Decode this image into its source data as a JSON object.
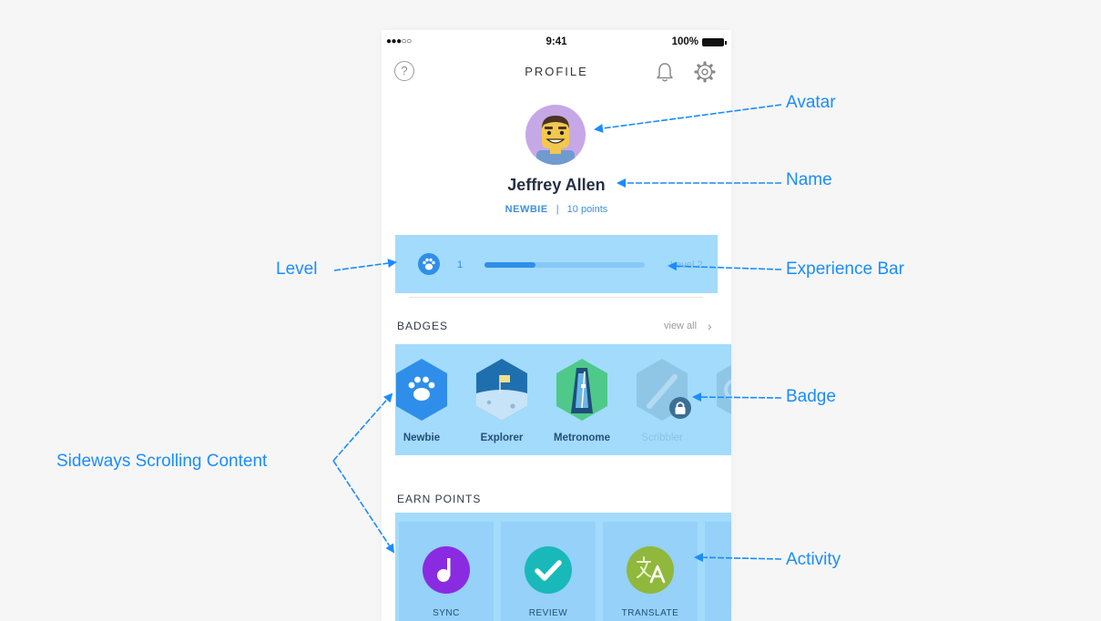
{
  "status_bar": {
    "signal": "●●●○○",
    "time": "9:41",
    "battery": "100%"
  },
  "header": {
    "title": "PROFILE",
    "help_glyph": "?",
    "icons": [
      "help-icon",
      "bell-icon",
      "gear-icon"
    ]
  },
  "profile": {
    "name": "Jeffrey Allen",
    "rank": "NEWBIE",
    "separator": "|",
    "points": "10 points",
    "avatar": "lego-minifigure-avatar"
  },
  "level": {
    "current": "1",
    "next_label": "Level 2",
    "progress": 0.32
  },
  "badges": {
    "title": "BADGES",
    "view_all": "view all",
    "items": [
      {
        "label": "Newbie",
        "locked": false,
        "color": "#2f8ee9"
      },
      {
        "label": "Explorer",
        "locked": false,
        "color": "#1f6fae"
      },
      {
        "label": "Metronome",
        "locked": false,
        "color": "#4fc98a"
      },
      {
        "label": "Scribbler",
        "locked": true,
        "color": "#8fc6e6"
      }
    ]
  },
  "earn_points": {
    "title": "EARN POINTS",
    "items": [
      {
        "label": "SYNC",
        "color": "#8a2be2"
      },
      {
        "label": "REVIEW",
        "color": "#19b9b9"
      },
      {
        "label": "TRANSLATE",
        "color": "#8fb83c"
      }
    ]
  },
  "annotations": {
    "avatar": "Avatar",
    "name": "Name",
    "level": "Level",
    "experience_bar": "Experience Bar",
    "badge": "Badge",
    "sideways": "Sideways Scrolling Content",
    "activity": "Activity"
  },
  "colors": {
    "accent": "#2f8ee9",
    "highlight": "#a3dbfd",
    "annotation": "#1a8cff"
  }
}
